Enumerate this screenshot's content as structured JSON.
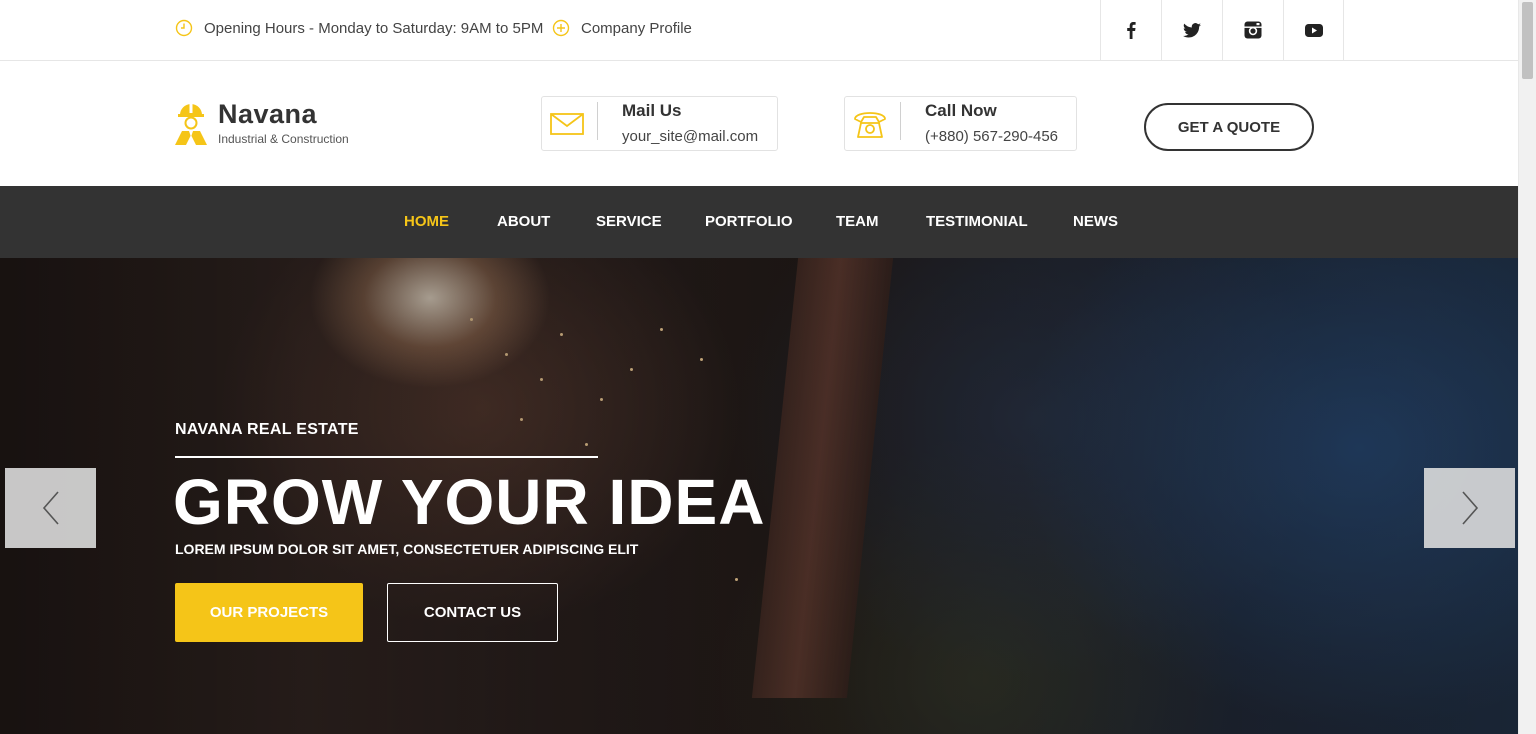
{
  "topbar": {
    "hours_text": "Opening Hours - Monday to Saturday: 9AM to 5PM",
    "profile_text": "Company Profile",
    "social": [
      "facebook-icon",
      "twitter-icon",
      "instagram-icon",
      "youtube-icon"
    ]
  },
  "brand": {
    "name": "Navana",
    "tagline": "Industrial & Construction"
  },
  "contact": {
    "mail_title": "Mail Us",
    "mail_value": "your_site@mail.com",
    "call_title": "Call Now",
    "call_value": "(+880) 567-290-456"
  },
  "header": {
    "quote_label": "GET A QUOTE"
  },
  "nav": {
    "items": [
      "HOME",
      "ABOUT",
      "SERVICE",
      "PORTFOLIO",
      "TEAM",
      "TESTIMONIAL",
      "NEWS"
    ],
    "active": "HOME"
  },
  "hero": {
    "kicker": "NAVANA REAL ESTATE",
    "title": "GROW YOUR IDEA",
    "subtitle": "LOREM IPSUM DOLOR SIT AMET, CONSECTETUER ADIPISCING ELIT",
    "primary_button": "OUR PROJECTS",
    "secondary_button": "CONTACT US"
  },
  "colors": {
    "accent": "#f5c518",
    "nav_bg": "#333333",
    "text_dark": "#333333"
  }
}
